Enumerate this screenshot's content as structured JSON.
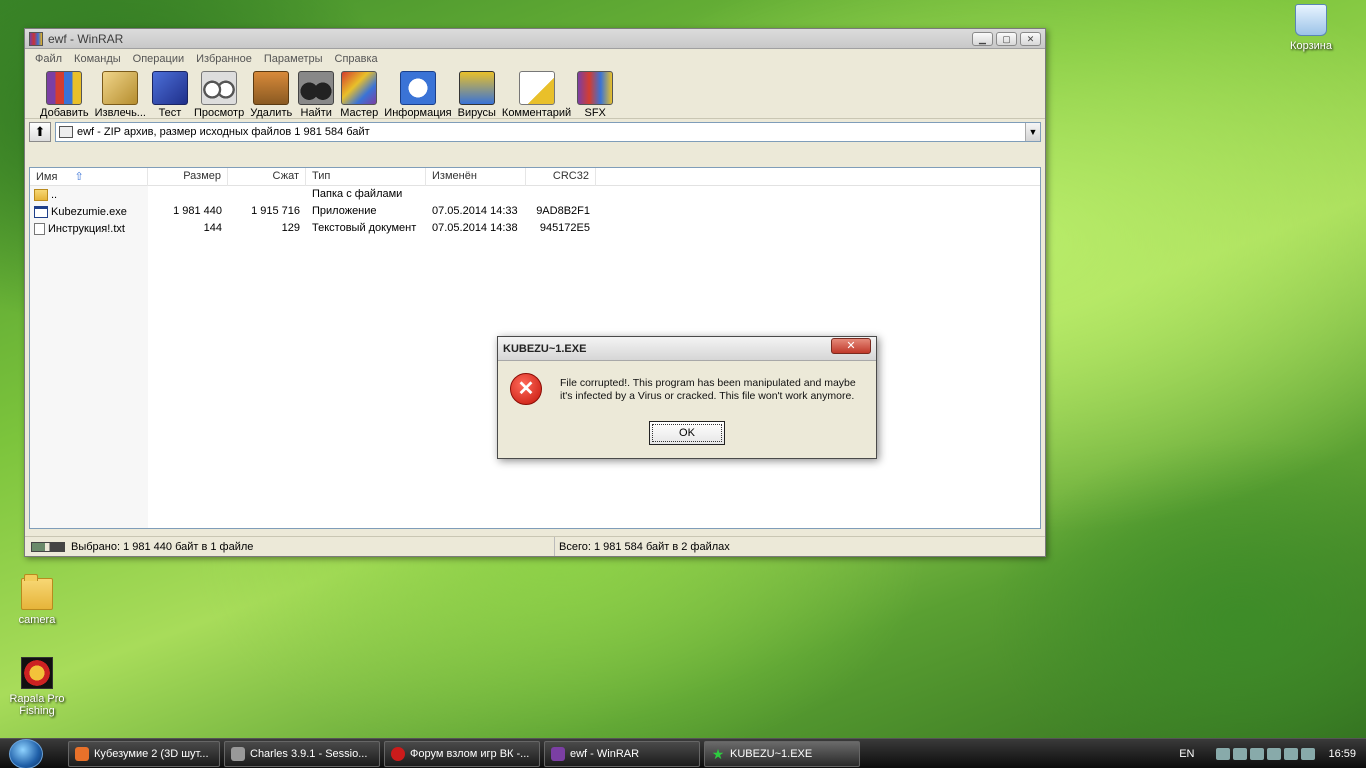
{
  "desktop": {
    "icons": [
      {
        "label": "camera"
      },
      {
        "label": "Rapala Pro Fishing"
      },
      {
        "label": "Корзина"
      }
    ]
  },
  "window": {
    "title": "ewf - WinRAR",
    "menu": [
      "Файл",
      "Команды",
      "Операции",
      "Избранное",
      "Параметры",
      "Справка"
    ],
    "toolbar": [
      {
        "label": "Добавить",
        "icon": "add-archive-icon"
      },
      {
        "label": "Извлечь...",
        "icon": "extract-icon"
      },
      {
        "label": "Тест",
        "icon": "test-icon"
      },
      {
        "label": "Просмотр",
        "icon": "view-icon"
      },
      {
        "label": "Удалить",
        "icon": "delete-icon"
      },
      {
        "label": "Найти",
        "icon": "find-icon"
      },
      {
        "label": "Мастер",
        "icon": "wizard-icon"
      },
      {
        "label": "Информация",
        "icon": "info-icon"
      },
      {
        "label": "Вирусы",
        "icon": "virus-scan-icon"
      },
      {
        "label": "Комментарий",
        "icon": "comment-icon"
      },
      {
        "label": "SFX",
        "icon": "sfx-icon"
      }
    ],
    "address": "ewf - ZIP архив, размер исходных файлов 1 981 584 байт",
    "columns": {
      "name": "Имя",
      "size": "Размер",
      "packed": "Сжат",
      "type": "Тип",
      "modified": "Изменён",
      "crc": "CRC32"
    },
    "files": [
      {
        "name": "..",
        "size": "",
        "packed": "",
        "type": "Папка с файлами",
        "modified": "",
        "crc": "",
        "kind": "folder"
      },
      {
        "name": "Kubezumie.exe",
        "size": "1 981 440",
        "packed": "1 915 716",
        "type": "Приложение",
        "modified": "07.05.2014 14:33",
        "crc": "9AD8B2F1",
        "kind": "exe"
      },
      {
        "name": "Инструкция!.txt",
        "size": "144",
        "packed": "129",
        "type": "Текстовый документ",
        "modified": "07.05.2014 14:38",
        "crc": "945172E5",
        "kind": "txt"
      }
    ],
    "status_left": "Выбрано: 1 981 440 байт в 1 файле",
    "status_right": "Всего: 1 981 584 байт в 2 файлах"
  },
  "dialog": {
    "title": "KUBEZU~1.EXE",
    "message": "File corrupted!. This program has been manipulated and maybe it's infected by a Virus or cracked. This file won't work anymore.",
    "ok": "OK"
  },
  "taskbar": {
    "tasks": [
      {
        "label": "Кубезумие 2 (3D шут...",
        "color": "#e8712a"
      },
      {
        "label": "Charles 3.9.1 - Sessio...",
        "color": "#999999"
      },
      {
        "label": "Форум взлом игр ВК -...",
        "color": "#cc1b1b"
      },
      {
        "label": "ewf - WinRAR",
        "color": "#7b3fa3"
      },
      {
        "label": "KUBEZU~1.EXE",
        "color": "#2ecc40"
      }
    ],
    "lang": "EN",
    "clock": "16:59"
  }
}
